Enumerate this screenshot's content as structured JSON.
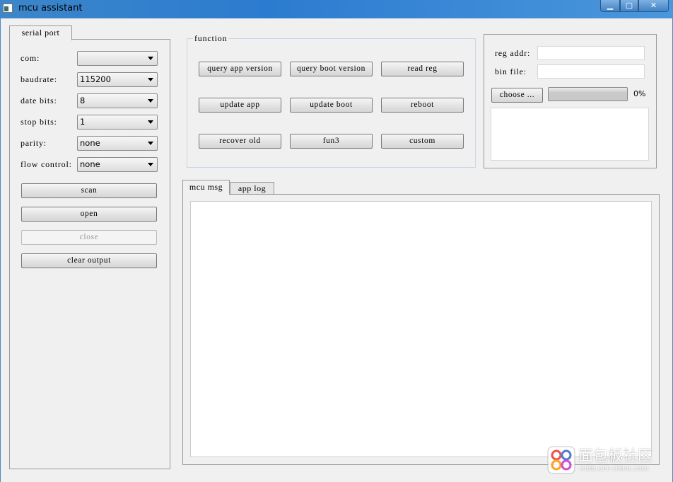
{
  "window": {
    "title": "mcu assistant",
    "minimize": "▁",
    "maximize": "▢",
    "close": "✕"
  },
  "serial": {
    "tab": "serial port",
    "fields": [
      {
        "label": "com:",
        "value": ""
      },
      {
        "label": "baudrate:",
        "value": "115200"
      },
      {
        "label": "date bits:",
        "value": "8"
      },
      {
        "label": "stop bits:",
        "value": "1"
      },
      {
        "label": "parity:",
        "value": "none"
      },
      {
        "label": "flow control:",
        "value": "none"
      }
    ],
    "scan": "scan",
    "open": "open",
    "close": "close",
    "clear": "clear output"
  },
  "function": {
    "title": "function",
    "buttons": [
      "query app version",
      "query boot version",
      "read reg",
      "update app",
      "update boot",
      "reboot",
      "recover old",
      "fun3",
      "custom"
    ]
  },
  "update": {
    "reg_addr_label": "reg addr:",
    "reg_addr": "",
    "bin_file_label": "bin file:",
    "bin_file": "",
    "choose": "choose ...",
    "progress": 0,
    "progress_text": "0%",
    "log": ""
  },
  "output": {
    "tabs": [
      "mcu msg",
      "app log"
    ],
    "active_tab": "mcu msg",
    "content": ""
  },
  "watermark": {
    "text": "面包板社区",
    "url": "mbb.eet-china.com"
  }
}
